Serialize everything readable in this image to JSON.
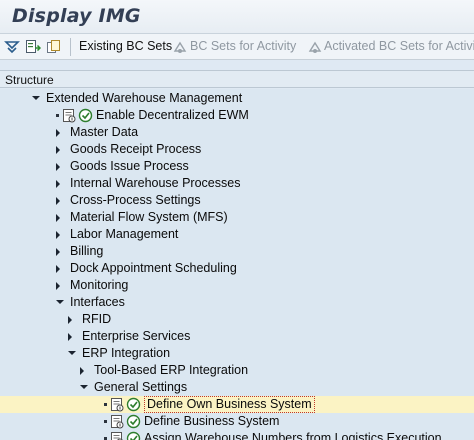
{
  "window": {
    "title": "Display IMG"
  },
  "toolbar": {
    "icons": [
      "filter-down-icon",
      "expand-icon",
      "copy-icon"
    ],
    "existing_bc_sets": "Existing BC Sets",
    "bc_sets_for_activity": "BC Sets for Activity",
    "activated_bc_sets": "Activated BC Sets for Activity"
  },
  "structure": {
    "header": "Structure"
  },
  "tree": [
    {
      "label": "Extended Warehouse Management",
      "state": "expanded"
    },
    {
      "label": "Enable Decentralized EWM",
      "state": "bullet",
      "icons": [
        "doc-icon",
        "execute-icon"
      ]
    },
    {
      "label": "Master Data",
      "state": "collapsed"
    },
    {
      "label": "Goods Receipt Process",
      "state": "collapsed"
    },
    {
      "label": "Goods Issue Process",
      "state": "collapsed"
    },
    {
      "label": "Internal Warehouse Processes",
      "state": "collapsed"
    },
    {
      "label": "Cross-Process Settings",
      "state": "collapsed"
    },
    {
      "label": "Material Flow System (MFS)",
      "state": "collapsed"
    },
    {
      "label": "Labor Management",
      "state": "collapsed"
    },
    {
      "label": "Billing",
      "state": "collapsed"
    },
    {
      "label": "Dock Appointment Scheduling",
      "state": "collapsed"
    },
    {
      "label": "Monitoring",
      "state": "collapsed"
    },
    {
      "label": "Interfaces",
      "state": "expanded"
    },
    {
      "label": "RFID",
      "state": "collapsed"
    },
    {
      "label": "Enterprise Services",
      "state": "collapsed"
    },
    {
      "label": "ERP Integration",
      "state": "expanded"
    },
    {
      "label": "Tool-Based ERP Integration",
      "state": "collapsed"
    },
    {
      "label": "General Settings",
      "state": "expanded"
    },
    {
      "label": "Define Own Business System",
      "state": "bullet",
      "icons": [
        "doc-icon",
        "execute-icon"
      ],
      "selected": true
    },
    {
      "label": "Define Business System",
      "state": "bullet",
      "icons": [
        "doc-icon",
        "execute-icon"
      ]
    },
    {
      "label": "Assign Warehouse Numbers from Logistics Execution",
      "state": "bullet",
      "icons": [
        "doc-icon",
        "execute-icon"
      ]
    }
  ]
}
